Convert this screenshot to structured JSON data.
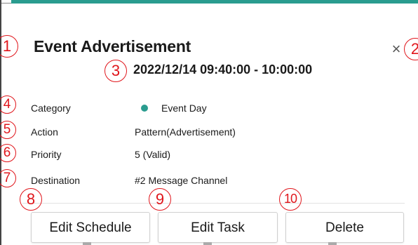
{
  "dialog": {
    "title": "Event Advertisement",
    "datetime": "2022/12/14 09:40:00 - 10:00:00",
    "close_icon": "×"
  },
  "details": [
    {
      "label": "Category",
      "value": "Event Day",
      "dot_color": "#2a9c8f"
    },
    {
      "label": "Action",
      "value": "Pattern(Advertisement)"
    },
    {
      "label": "Priority",
      "value": "5 (Valid)"
    },
    {
      "label": "Destination",
      "value": "#2 Message Channel"
    }
  ],
  "buttons": {
    "edit_schedule": "Edit Schedule",
    "edit_task": "Edit Task",
    "delete": "Delete"
  },
  "callouts": [
    "1",
    "2",
    "3",
    "4",
    "5",
    "6",
    "7",
    "8",
    "9",
    "10"
  ],
  "colors": {
    "accent": "#2a9c8f",
    "callout": "#e0151b"
  }
}
